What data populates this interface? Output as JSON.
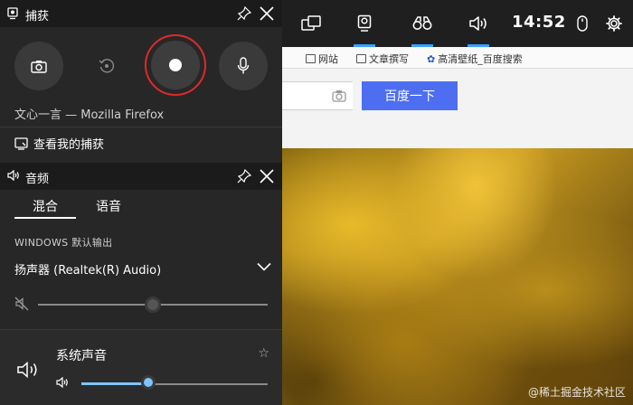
{
  "browser": {
    "bookmarks": [
      "网站",
      "文章撰写",
      "高清壁纸_百度搜索"
    ],
    "search_button": "百度一下"
  },
  "watermark": "@稀土掘金技术社区",
  "topbar": {
    "icons": [
      "widget-menu-icon",
      "capture-icon",
      "performance-icon",
      "audio-icon",
      "mouse-icon",
      "settings-icon"
    ],
    "clock": "14:52",
    "active_tabs": [
      "capture",
      "performance",
      "audio"
    ]
  },
  "capture": {
    "title": "捕获",
    "app": "文心一言 — Mozilla Firefox",
    "see_captures": "查看我的捕获",
    "record_color": "#e02a2a"
  },
  "audio": {
    "title": "音频",
    "tabs": [
      "混合",
      "语音"
    ],
    "active_tab": "混合",
    "section_label": "WINDOWS 默认输出",
    "device": "扬声器 (Realtek(R) Audio)",
    "master_volume": 0.5,
    "master_muted": true,
    "apps": [
      {
        "name": "系统声音",
        "volume": 0.36
      }
    ],
    "accent": "#7fc4ff"
  }
}
